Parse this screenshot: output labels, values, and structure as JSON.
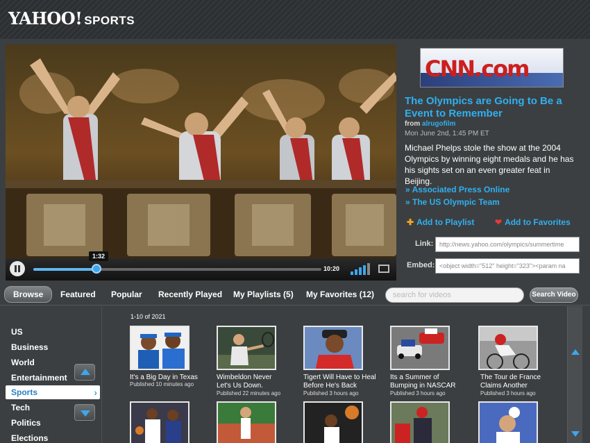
{
  "header": {
    "logo_text": "YAHOO!",
    "logo_section": "SPORTS"
  },
  "player": {
    "current_time": "1:32",
    "duration": "10:20",
    "progress_fraction": 0.22
  },
  "story": {
    "source_logo": "CNN.com",
    "title": "The Olympics are Going to Be a Event to Remember",
    "from_label": "from",
    "from_user": "alrugofilm",
    "date": "Mon June 2nd, 1:45 PM ET",
    "description": "Michael Phelps stole the show at the 2004 Olympics by winning eight medals and he has his sights set on an even greater feat in Beijing.",
    "related_links": [
      "» Associated Press Online",
      "» The US Olympic Team"
    ],
    "add_playlist": "Add to Playlist",
    "add_favorites": "Add to Favorites",
    "link_label": "Link:",
    "link_value": "http://news.yahoo.com/olympics/summertime",
    "embed_label": "Embed:",
    "embed_value": "<object width=\"512\" height=\"323\"><param na"
  },
  "tabs": {
    "items": [
      "Browse",
      "Featured",
      "Popular",
      "Recently Played",
      "My Playlists (5)",
      "My Favorites (12)"
    ],
    "search_placeholder": "search for videos",
    "search_button": "Search Video"
  },
  "categories": {
    "items": [
      "US",
      "Business",
      "World",
      "Entertainment",
      "Sports",
      "Tech",
      "Politics",
      "Elections"
    ],
    "selected": "Sports"
  },
  "results": {
    "count_label": "1-10 of 2021",
    "videos": [
      {
        "title": "It's a Big Day in Texas",
        "published": "Published 10 minutes ago"
      },
      {
        "title": "Wimbeldon Never Let's Us Down.",
        "published": "Published 22 minutes ago"
      },
      {
        "title": "Tigert Will Have to Heal Before He's Back",
        "published": "Published 3 hours ago"
      },
      {
        "title": "Its a Summer of Bumping in NASCAR",
        "published": "Published 3 hours ago"
      },
      {
        "title": "The Tour de France Claims Another",
        "published": "Published 3 hours ago"
      }
    ]
  },
  "colors": {
    "accent": "#30b0f0",
    "background": "#3c3f41",
    "favorite": "#e23b3b",
    "playlist": "#f5a623"
  }
}
